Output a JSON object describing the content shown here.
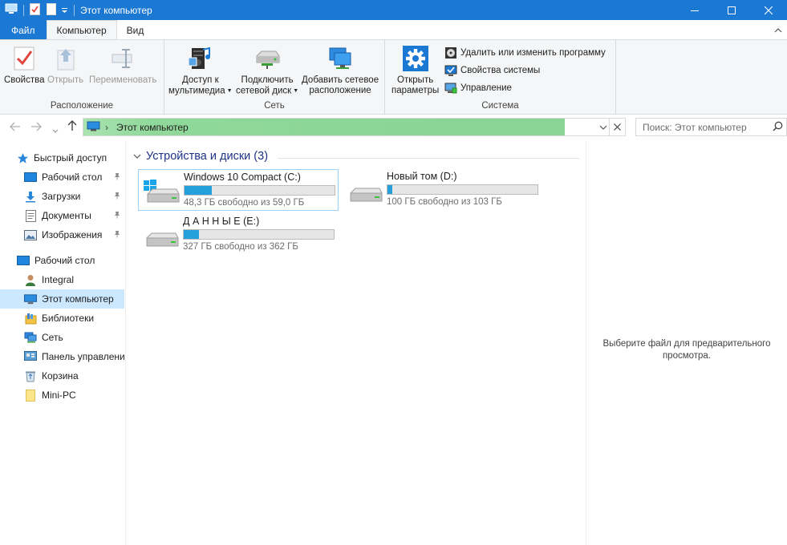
{
  "window": {
    "title": "Этот компьютер"
  },
  "ribbon_tabs": [
    {
      "label": "Файл"
    },
    {
      "label": "Компьютер"
    },
    {
      "label": "Вид"
    }
  ],
  "ribbon": {
    "location": {
      "label": "Расположение",
      "properties": "Свойства",
      "open": "Открыть",
      "rename": "Переименовать"
    },
    "network": {
      "label": "Сеть",
      "media_line1": "Доступ к",
      "media_line2": "мультимедиа",
      "map_line1": "Подключить",
      "map_line2": "сетевой диск",
      "addloc_line1": "Добавить сетевое",
      "addloc_line2": "расположение"
    },
    "system": {
      "label": "Система",
      "settings_line1": "Открыть",
      "settings_line2": "параметры",
      "uninstall": "Удалить или изменить программу",
      "sysprops": "Свойства системы",
      "manage": "Управление"
    }
  },
  "address": {
    "path": "Этот компьютер",
    "search_placeholder": "Поиск: Этот компьютер"
  },
  "nav_pane": {
    "quick_access": "Быстрый доступ",
    "quick_items": [
      {
        "label": "Рабочий стол"
      },
      {
        "label": "Загрузки"
      },
      {
        "label": "Документы"
      },
      {
        "label": "Изображения"
      }
    ],
    "tree": [
      {
        "label": "Рабочий стол"
      },
      {
        "label": "Integral"
      },
      {
        "label": "Этот компьютер"
      },
      {
        "label": "Библиотеки"
      },
      {
        "label": "Сеть"
      },
      {
        "label": "Панель управлени"
      },
      {
        "label": "Корзина"
      },
      {
        "label": "Mini-PC"
      }
    ]
  },
  "devices": {
    "header": "Устройства и диски (3)",
    "drives": [
      {
        "name": "Windows 10 Compact (C:)",
        "free": "48,3 ГБ свободно из 59,0 ГБ",
        "used_fraction": 0.18
      },
      {
        "name": "Новый том (D:)",
        "free": "100 ГБ свободно из 103 ГБ",
        "used_fraction": 0.03
      },
      {
        "name": "Д А Н Н Ы Е (E:)",
        "free": "327 ГБ свободно из 362 ГБ",
        "used_fraction": 0.1
      }
    ]
  },
  "preview": {
    "line1": "Выберите файл для предварительного",
    "line2": "просмотра."
  },
  "colors": {
    "accent": "#1b78d3",
    "selection": "#cce8ff",
    "drive_bar": "#26a0da",
    "address_fill": "#8ad596"
  }
}
